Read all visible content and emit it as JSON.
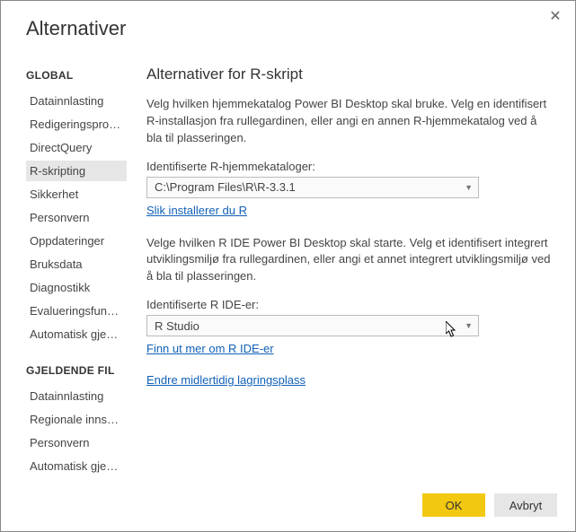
{
  "dialog": {
    "title": "Alternativer",
    "close_label": "✕"
  },
  "sidebar": {
    "global_header": "GLOBAL",
    "global_items": [
      "Datainnlasting",
      "Redigeringsprogr…",
      "DirectQuery",
      "R-skripting",
      "Sikkerhet",
      "Personvern",
      "Oppdateringer",
      "Bruksdata",
      "Diagnostikk",
      "Evalueringsfunksj…",
      "Automatisk gjeno…"
    ],
    "global_selected_index": 3,
    "current_file_header": "GJELDENDE FIL",
    "current_file_items": [
      "Datainnlasting",
      "Regionale innstilli…",
      "Personvern",
      "Automatisk gjeno…"
    ]
  },
  "content": {
    "title": "Alternativer for R-skript",
    "desc1": "Velg hvilken hjemmekatalog Power BI Desktop skal bruke. Velg en identifisert R-installasjon fra rullegardinen, eller angi en annen R-hjemmekatalog ved å bla til plasseringen.",
    "home_label": "Identifiserte R-hjemmekataloger:",
    "home_value": "C:\\Program Files\\R\\R-3.3.1",
    "home_link": "Slik installerer du R",
    "desc2": "Velge hvilken R IDE Power BI Desktop skal starte. Velg et identifisert integrert utviklingsmiljø fra rullegardinen, eller angi et annet integrert utviklingsmiljø ved å bla til plasseringen.",
    "ide_label": "Identifiserte R IDE-er:",
    "ide_value": "R Studio",
    "ide_link": "Finn ut mer om R IDE-er",
    "temp_link": "Endre midlertidig lagringsplass"
  },
  "footer": {
    "ok": "OK",
    "cancel": "Avbryt"
  }
}
